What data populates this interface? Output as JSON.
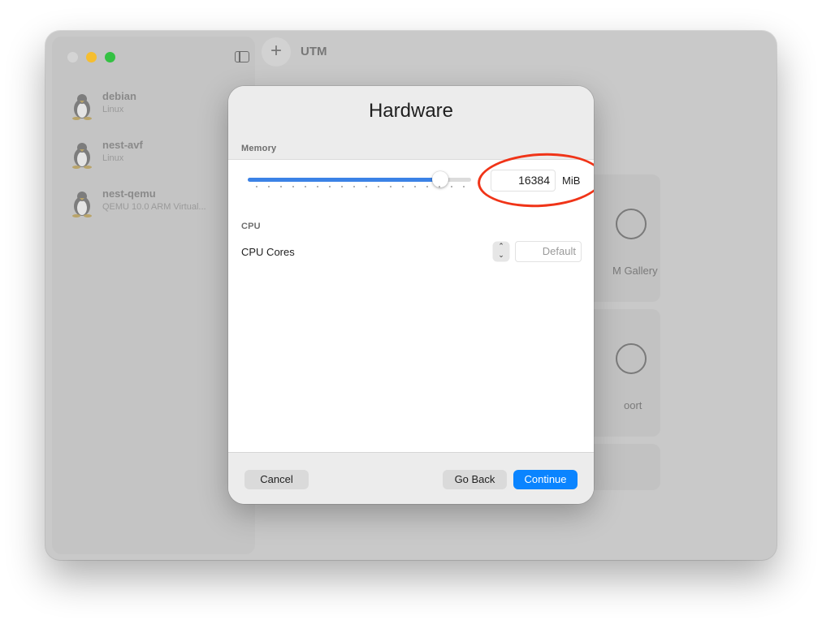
{
  "window": {
    "title": "UTM",
    "add_symbol": "+"
  },
  "sidebar": {
    "vms": [
      {
        "name": "debian",
        "subtitle": "Linux",
        "icon": "tux-icon"
      },
      {
        "name": "nest-avf",
        "subtitle": "Linux",
        "icon": "tux-icon"
      },
      {
        "name": "nest-qemu",
        "subtitle": "QEMU 10.0 ARM Virtual...",
        "icon": "tux-icon"
      }
    ]
  },
  "background_cards": [
    {
      "label": "M Gallery"
    },
    {
      "label": "oort"
    }
  ],
  "dialog": {
    "title": "Hardware",
    "memory": {
      "section_label": "Memory",
      "value": "16384",
      "unit": "MiB",
      "slider_fraction": 0.86,
      "annotation_color": "#f03418"
    },
    "cpu": {
      "section_label": "CPU",
      "cores_label": "CPU Cores",
      "cores_placeholder": "Default"
    },
    "buttons": {
      "cancel": "Cancel",
      "go_back": "Go Back",
      "continue": "Continue"
    }
  },
  "colors": {
    "accent": "#0a84ff",
    "slider_fill": "#3b82e6",
    "traffic_close": "#d4d4d4",
    "traffic_minimize": "#f6be2f",
    "traffic_maximize": "#34c143"
  }
}
